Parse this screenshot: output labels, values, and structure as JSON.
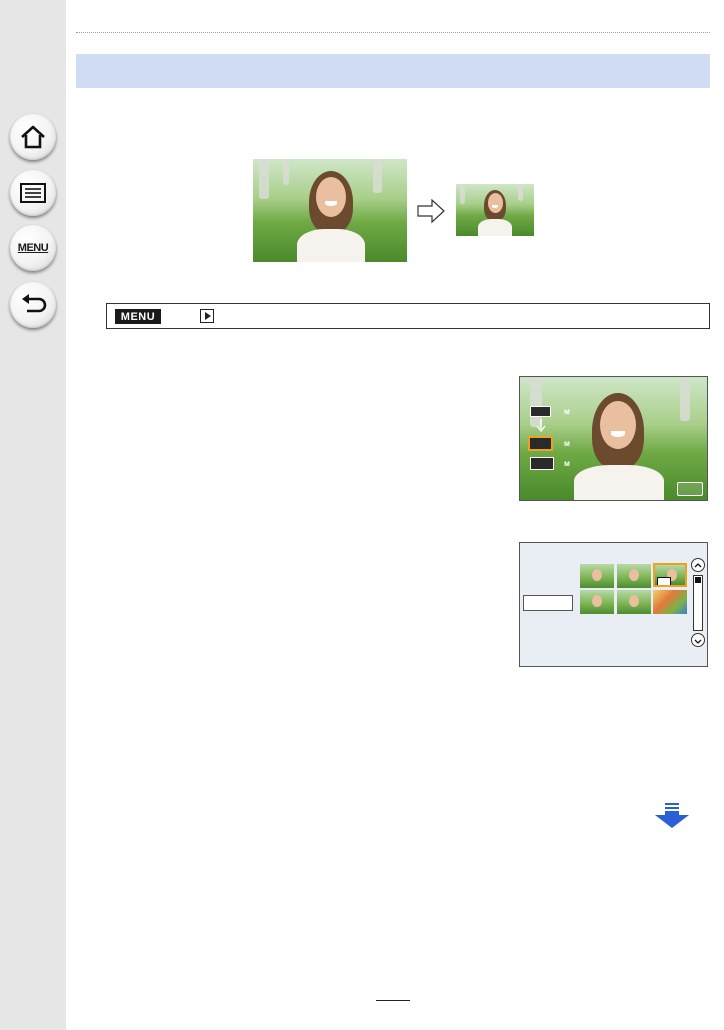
{
  "sidebar": {
    "items": [
      {
        "name": "home",
        "icon": "home-icon"
      },
      {
        "name": "contents",
        "icon": "list-icon"
      },
      {
        "name": "menu",
        "icon": "menu-icon",
        "label": "MENU"
      },
      {
        "name": "back",
        "icon": "back-arrow-icon"
      }
    ]
  },
  "menu_path": {
    "badge_label": "MENU",
    "playback_icon": "playback-icon"
  },
  "next_page_icon": "next-page-arrow-icon",
  "colors": {
    "header_band": "#cfdcf3",
    "sidebar": "#e6e6e6",
    "selection": "#f0a020",
    "next_arrow": "#2a5fd6"
  }
}
